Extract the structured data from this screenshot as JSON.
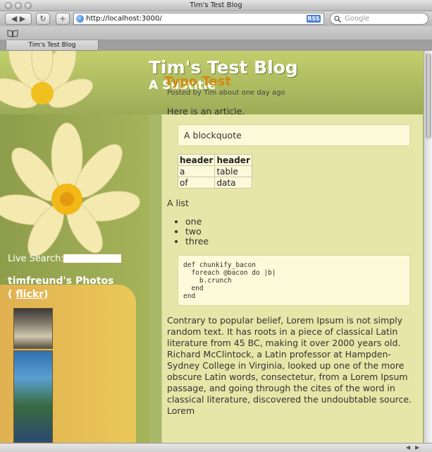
{
  "window": {
    "title": "Tim's Test Blog"
  },
  "toolbar": {
    "back_label": "◀ ▶",
    "reload_label": "↻",
    "add_label": "+",
    "url": "http://localhost:3000/",
    "rss_label": "RSS",
    "search_placeholder": "Google"
  },
  "tabs": [
    {
      "label": "Tim's Test Blog"
    }
  ],
  "blog": {
    "title": "Tim's Test Blog",
    "subtitle": "A Subtitle"
  },
  "sidebar": {
    "live_search_label": "Live Search:",
    "photos_title": "timfreund's Photos",
    "photos_link_prefix": "( ",
    "photos_link": "flickr",
    "photos_link_suffix": ")"
  },
  "post": {
    "title": "Typo Test",
    "posted_by": "Posted by Tim about one day ago",
    "intro": "Here is an article.",
    "blockquote": "A blockquote",
    "table": {
      "headers": [
        "header",
        "header"
      ],
      "rows": [
        [
          "a",
          "table"
        ],
        [
          "of",
          "data"
        ]
      ]
    },
    "list_label": "A list",
    "list_items": [
      "one",
      "two",
      "three"
    ],
    "code": "def chunkify_bacon\n  foreach @bacon do |b|\n    b.crunch\n  end\nend",
    "body": "Contrary to popular belief, Lorem Ipsum is not simply random text. It has roots in a piece of classical Latin literature from 45 BC, making it over 2000 years old. Richard McClintock, a Latin professor at Hampden-Sydney College in Virginia, looked up one of the more obscure Latin words, consectetur, from a Lorem Ipsum passage, and going through the cites of the word in classical literature, discovered the undoubtable source. Lorem"
  },
  "colors": {
    "header_green": "#b4c366",
    "post_title_orange": "#d48a12",
    "content_bg": "#e6e6a8",
    "sidebar_panel": "#e4bc54"
  }
}
